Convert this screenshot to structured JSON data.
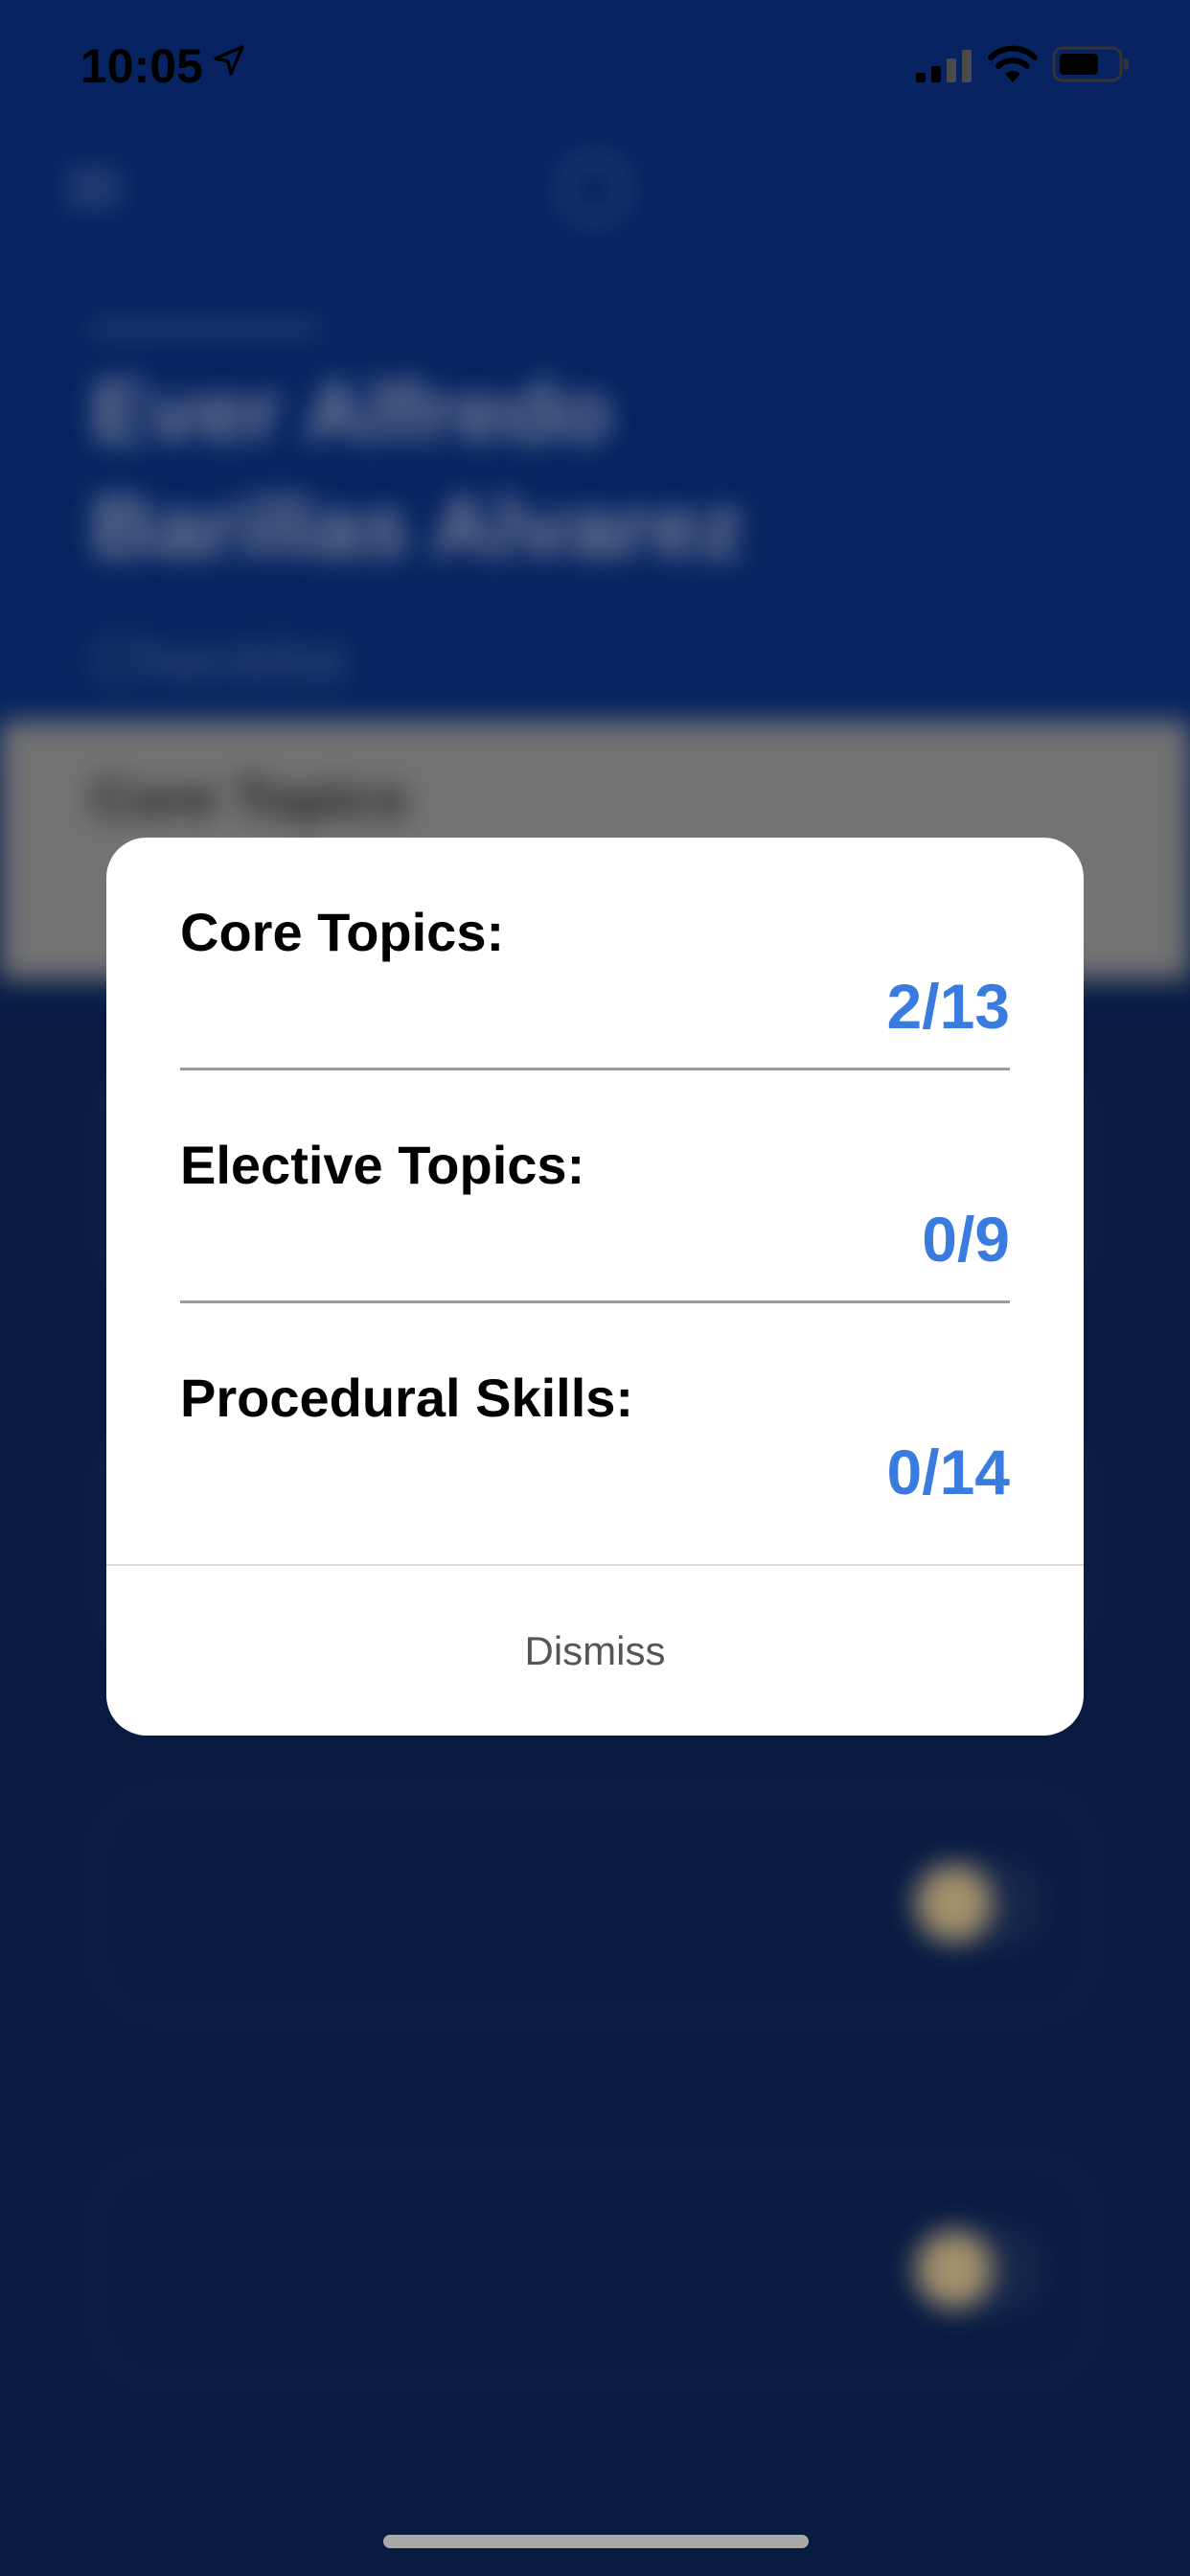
{
  "status_bar": {
    "time": "10:05",
    "icons": [
      "location-arrow-icon",
      "cellular-signal-icon",
      "wifi-icon",
      "battery-icon"
    ]
  },
  "background_screen": {
    "title": "Ever Alfredo Barillas Alvarez",
    "subtitle": "Checklist",
    "section_label": "Core Topics"
  },
  "modal": {
    "rows": [
      {
        "label": "Core Topics:",
        "value": "2/13"
      },
      {
        "label": "Elective Topics:",
        "value": "0/9"
      },
      {
        "label": "Procedural Skills:",
        "value": "0/14"
      }
    ],
    "dismiss_label": "Dismiss"
  },
  "colors": {
    "background_blue": "#0a2b78",
    "accent_value": "#3a7be0",
    "modal_background": "#ffffff",
    "toggle_knob": "#c8b184"
  }
}
